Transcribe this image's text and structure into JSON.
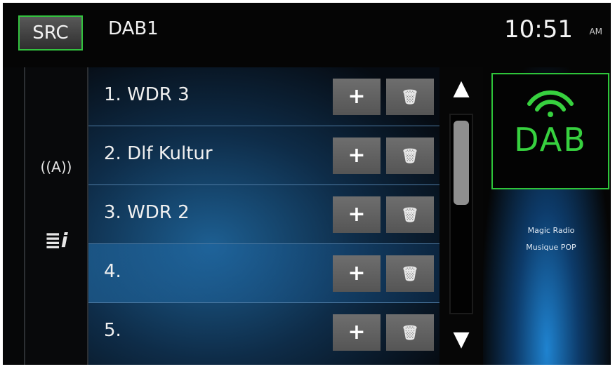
{
  "header": {
    "src_label": "SRC",
    "source_title": "DAB1",
    "time": "10:51",
    "ampm": "AM"
  },
  "sidebar": {
    "antenna_glyph": "((A))",
    "info_glyph": "≣i"
  },
  "stations": [
    {
      "label": "1.  WDR 3"
    },
    {
      "label": "2.  Dlf Kultur"
    },
    {
      "label": "3.  WDR 2"
    },
    {
      "label": "4."
    },
    {
      "label": "5."
    }
  ],
  "buttons": {
    "add_glyph": "+",
    "delete_glyph": "🗑"
  },
  "scroll": {
    "up_glyph": "▲",
    "down_glyph": "▼"
  },
  "now_playing": {
    "logo_text": "DAB",
    "line1": "Magic Radio",
    "line2": "Musique POP"
  },
  "colors": {
    "accent_green": "#33c23f",
    "list_blue": "#1d5f92"
  }
}
